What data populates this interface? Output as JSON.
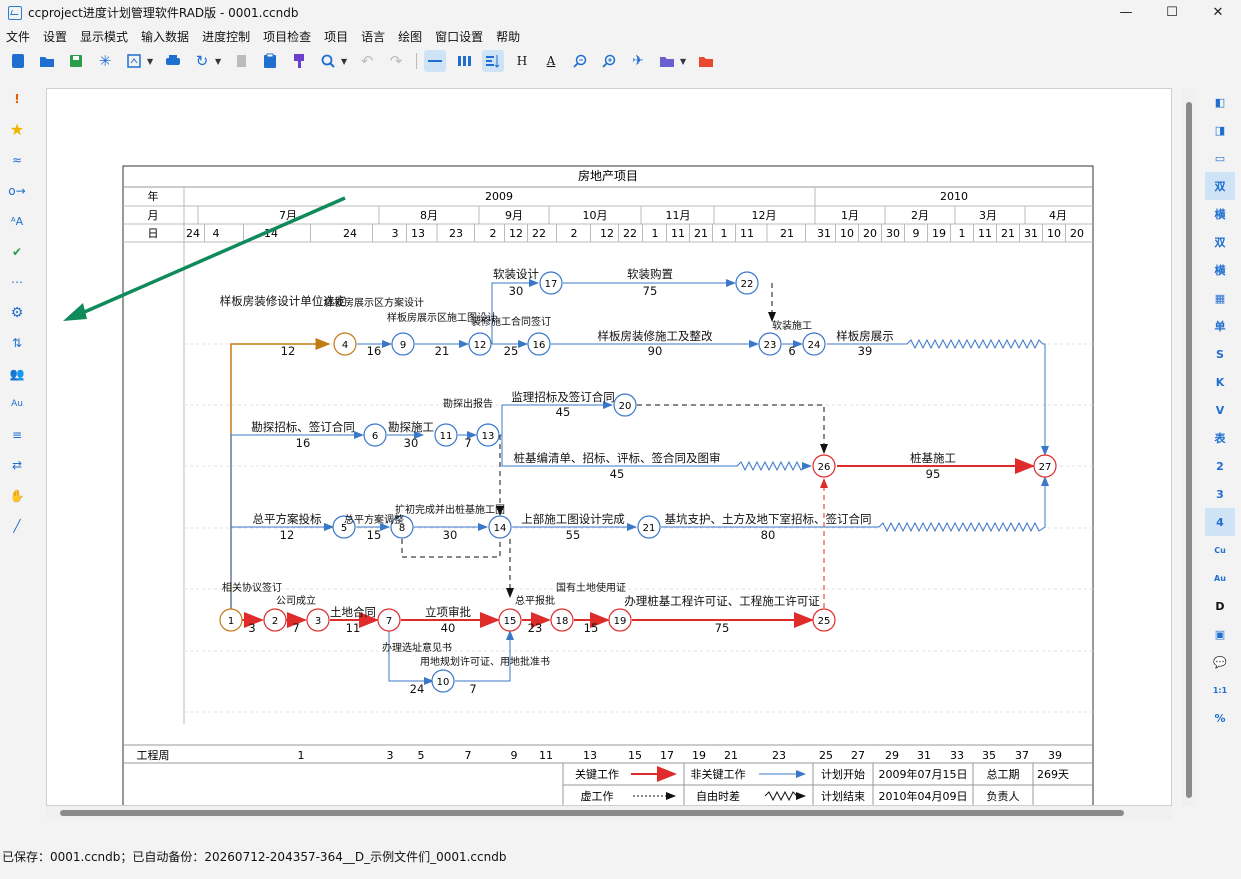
{
  "window": {
    "title": "ccproject进度计划管理软件RAD版 - 0001.ccndb",
    "minimize": "—",
    "maximize": "☐",
    "close": "✕"
  },
  "menu": [
    "文件",
    "设置",
    "显示模式",
    "输入数据",
    "进度控制",
    "项目检查",
    "项目",
    "语言",
    "绘图",
    "窗口设置",
    "帮助"
  ],
  "toolbar_icons": [
    "new-icon",
    "open-icon",
    "save-icon",
    "star-icon",
    "export-icon",
    "print-icon",
    "refresh-icon",
    "copy-icon",
    "paste-icon",
    "brush-icon",
    "zoom-icon",
    "undo-icon",
    "redo-icon",
    "line-icon",
    "bar-icon",
    "sort-icon",
    "h-icon",
    "a-icon",
    "zoom-out-icon",
    "zoom-in-icon",
    "plane-icon",
    "folder-icon",
    "red-folder-icon"
  ],
  "left_icons": [
    "alert-icon",
    "star-icon",
    "wave-icon",
    "arrow-icon",
    "text-icon",
    "check-icon",
    "dots-icon",
    "gear-icon",
    "sort-icon",
    "users-icon",
    "au-icon",
    "filter-icon",
    "swap-icon",
    "hand-icon",
    "pen-icon"
  ],
  "right_buttons": [
    "◧",
    "◨",
    "▭",
    "双",
    "横",
    "双",
    "横",
    "▦",
    "单",
    "S",
    "K",
    "V",
    "表",
    "2",
    "3",
    "4",
    "Cu",
    "Au",
    "D",
    "▣",
    "💬",
    "1:1",
    "%"
  ],
  "chart": {
    "title": "房地产项目",
    "row_labels": {
      "year": "年",
      "month": "月",
      "day": "日",
      "week": "工程周"
    },
    "years": [
      "2009",
      "2010"
    ],
    "months": [
      "7月",
      "8月",
      "9月",
      "10月",
      "11月",
      "12月",
      "1月",
      "2月",
      "3月",
      "4月"
    ],
    "days": [
      "24",
      "4",
      "14",
      "24",
      "3",
      "13",
      "23",
      "2",
      "12",
      "22",
      "2",
      "12",
      "22",
      "1",
      "11",
      "21",
      "1",
      "11",
      "21",
      "31",
      "10",
      "20",
      "30",
      "9",
      "19",
      "1",
      "11",
      "21",
      "31",
      "10",
      "20"
    ],
    "weeks": [
      "1",
      "3",
      "5",
      "7",
      "9",
      "11",
      "13",
      "15",
      "17",
      "19",
      "21",
      "23",
      "25",
      "27",
      "29",
      "31",
      "33",
      "35",
      "37",
      "39"
    ],
    "tasks": [
      {
        "name": "样板房装修设计单位选定",
        "dur": "12"
      },
      {
        "name": "样板房展示区方案设计",
        "dur": "16"
      },
      {
        "name": "样板房展示区施工图设计",
        "dur": "21"
      },
      {
        "name": "装修施工合同签订",
        "dur": "25"
      },
      {
        "name": "软装设计",
        "dur": "30"
      },
      {
        "name": "软装购置",
        "dur": "75"
      },
      {
        "name": "样板房装修施工及整改",
        "dur": "90"
      },
      {
        "name": "软装施工",
        "dur": "6"
      },
      {
        "name": "样板房展示",
        "dur": "39"
      },
      {
        "name": "勘探招标、签订合同",
        "dur": "16"
      },
      {
        "name": "勘探施工",
        "dur": "30"
      },
      {
        "name": "勘探出报告",
        "dur": "7"
      },
      {
        "name": "监理招标及签订合同",
        "dur": "45"
      },
      {
        "name": "桩基编清单、招标、评标、签合同及图审",
        "dur": "45"
      },
      {
        "name": "桩基施工",
        "dur": "95"
      },
      {
        "name": "总平方案投标",
        "dur": "12"
      },
      {
        "name": "总平方案调整",
        "dur": "15"
      },
      {
        "name": "扩初完成并出桩基施工图",
        "dur": "30"
      },
      {
        "name": "上部施工图设计完成",
        "dur": "55"
      },
      {
        "name": "基坑支护、土方及地下室招标、签订合同",
        "dur": "80"
      },
      {
        "name": "相关协议签订",
        "dur": "3"
      },
      {
        "name": "公司成立",
        "dur": "7"
      },
      {
        "name": "土地合同",
        "dur": "11"
      },
      {
        "name": "立项审批",
        "dur": "40"
      },
      {
        "name": "总平报批",
        "dur": "23"
      },
      {
        "name": "国有土地使用证",
        "dur": "15"
      },
      {
        "name": "办理桩基工程许可证、工程施工许可证",
        "dur": "75"
      },
      {
        "name": "办理选址意见书",
        "dur": "24"
      },
      {
        "name": "用地规划许可证、用地批准书",
        "dur": "7"
      }
    ],
    "legend": {
      "critical": "关键工作",
      "noncritical": "非关键工作",
      "dummy": "虚工作",
      "float": "自由时差",
      "plan_start_label": "计划开始",
      "plan_start": "2009年07月15日",
      "plan_end_label": "计划结束",
      "plan_end": "2010年04月09日",
      "duration_label": "总工期",
      "duration": "269天",
      "owner_label": "负责人",
      "owner": ""
    }
  },
  "status": "已保存：0001.ccndb；已自动备份：20260712-204357-364__D_示例文件们_0001.ccndb"
}
